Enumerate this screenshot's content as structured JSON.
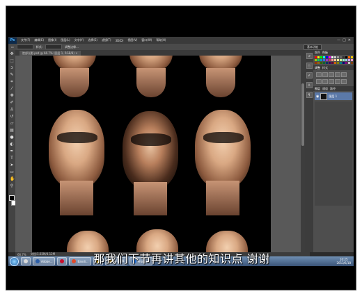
{
  "video": {
    "subtitle": "那我们下节再讲其他的知识点  谢谢"
  },
  "app": {
    "logo": "Ps",
    "menu": [
      "文件(F)",
      "编辑(E)",
      "图像(I)",
      "图层(L)",
      "文字(Y)",
      "选择(S)",
      "滤镜(T)",
      "3D(D)",
      "视图(V)",
      "窗口(W)",
      "帮助(H)"
    ],
    "window_controls": [
      "—",
      "□",
      "✕"
    ]
  },
  "options_bar": {
    "left_label": "样式:",
    "mid_label": "调整边缘...",
    "workspace": "基本功能"
  },
  "document_tab": {
    "title": "脸部光影.psd @ 66.7% (图层 1, RGB/8)",
    "close": "✕"
  },
  "panels": {
    "color_tabs": [
      "颜色",
      "色板"
    ],
    "adjust_tabs": [
      "调整",
      "样式"
    ],
    "layers_tabs": [
      "图层",
      "通道",
      "路径"
    ],
    "layer_name": "图层 1",
    "swatch_colors": [
      "#ff0000",
      "#ffff00",
      "#00ff00",
      "#00ffff",
      "#0000ff",
      "#ff00ff",
      "#ffffff",
      "#cccccc",
      "#999999",
      "#666666",
      "#333333",
      "#000000",
      "#ff6600",
      "#ffcc00",
      "#99cc00",
      "#00cc66",
      "#0099cc",
      "#3366ff",
      "#9933cc",
      "#cc3366",
      "#ff9999",
      "#ffcc99",
      "#ffff99",
      "#ccff99",
      "#99ffcc",
      "#99ccff",
      "#cc99ff",
      "#ff99cc",
      "#993300",
      "#996600",
      "#336600",
      "#006633",
      "#003366",
      "#330066",
      "#660033",
      "#cc6600",
      "#808000",
      "#008080",
      "#000080",
      "#800080",
      "#c0c0c0",
      "#804000"
    ]
  },
  "status_bar": {
    "zoom": "66.7%",
    "doc_info": "文档:1.03M/4.12M"
  },
  "taskbar": {
    "buttons": [
      {
        "label": "",
        "color": "#d9d9d9"
      },
      {
        "label": "Adobe...",
        "color": "#2d5fa8"
      },
      {
        "label": "",
        "color": "#c8102e"
      },
      {
        "label": "Bandi...",
        "color": "#e04a2a"
      },
      {
        "label": "",
        "color": "#f5c400"
      },
      {
        "label": "学习资料",
        "color": "#f0c050"
      },
      {
        "label": "Photos...",
        "color": "#1e6fd9"
      }
    ],
    "time": "10:25",
    "date": "2013/6/18"
  }
}
